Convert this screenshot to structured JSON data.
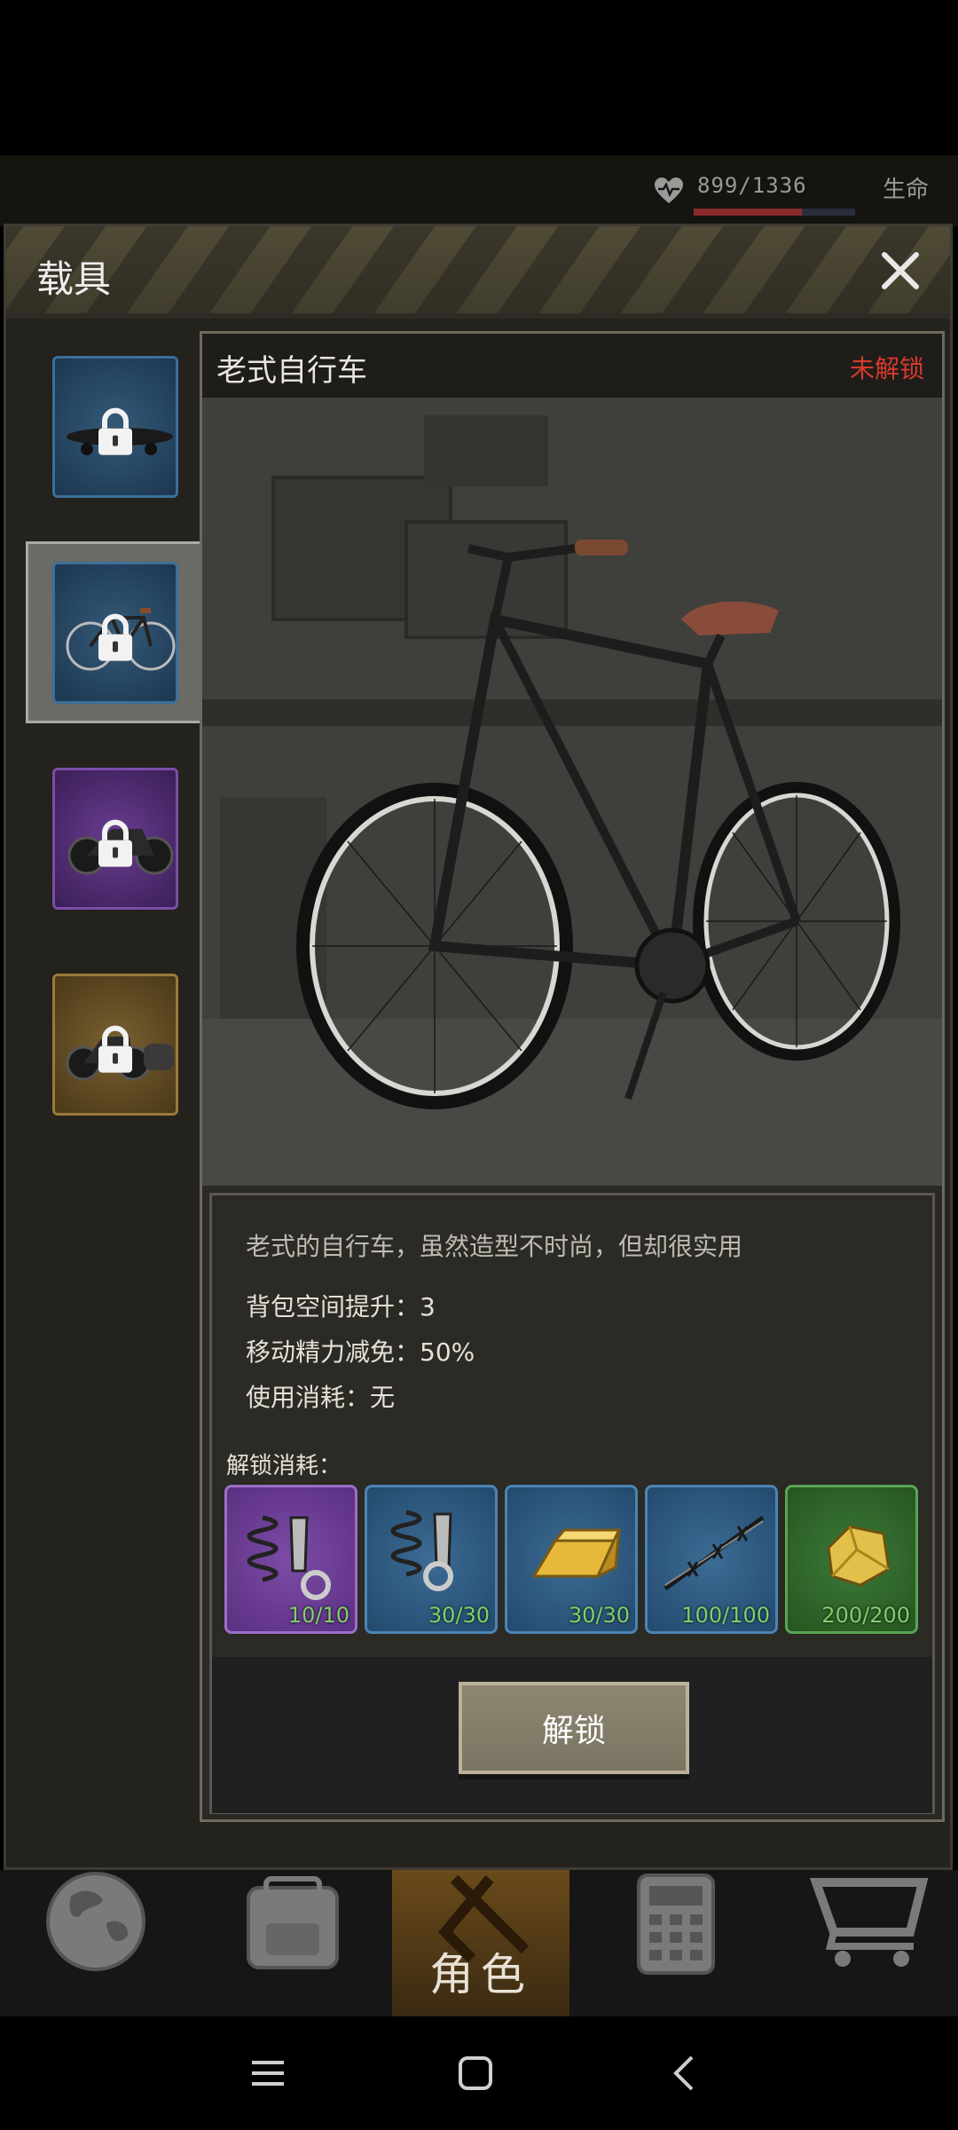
{
  "hud": {
    "hp_value": "899/1336",
    "hp_fraction": 0.673,
    "hp_label": "生命"
  },
  "modal": {
    "title": "载具",
    "close_icon": "close-icon"
  },
  "vehicles": [
    {
      "name": "skateboard",
      "rarity": "blue",
      "locked": true,
      "selected": false
    },
    {
      "name": "bicycle",
      "rarity": "blue",
      "locked": true,
      "selected": true
    },
    {
      "name": "motorcycle",
      "rarity": "purple",
      "locked": true,
      "selected": false
    },
    {
      "name": "sidecar-motorcycle",
      "rarity": "gold",
      "locked": true,
      "selected": false
    }
  ],
  "detail": {
    "name": "老式自行车",
    "status": "未解锁",
    "description": "老式的自行车，虽然造型不时尚，但却很实用",
    "stats": [
      "背包空间提升：3",
      "移动精力减免：50%",
      "使用消耗：无"
    ],
    "cost_label": "解锁消耗：",
    "costs": [
      {
        "icon": "spring-bolt-icon",
        "rarity": "purple",
        "qty": "10/10"
      },
      {
        "icon": "spring-bolt-icon",
        "rarity": "blue",
        "qty": "30/30"
      },
      {
        "icon": "gold-bar-icon",
        "rarity": "blue",
        "qty": "30/30"
      },
      {
        "icon": "barbed-wire-icon",
        "rarity": "blue",
        "qty": "100/100"
      },
      {
        "icon": "gold-nugget-icon",
        "rarity": "green",
        "qty": "200/200"
      }
    ],
    "unlock_label": "解锁"
  },
  "game_nav": {
    "items": [
      "globe-icon",
      "backpack-icon",
      "role",
      "calculator-icon",
      "cart-icon"
    ],
    "role_label": "角色"
  },
  "colors": {
    "locked_status": "#d83a2c",
    "qty_text": "#7fd06a"
  }
}
